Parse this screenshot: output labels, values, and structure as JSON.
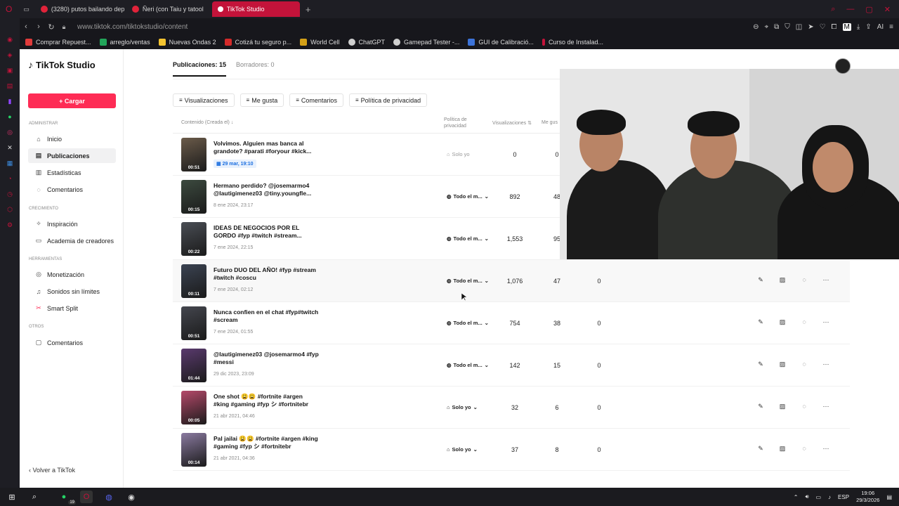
{
  "browser": {
    "tabs": [
      {
        "label": "(3280) putos bailando dep",
        "color": "#e0233a"
      },
      {
        "label": "Ñeri (con Taiu y tatool",
        "color": "#e0233a"
      },
      {
        "label": "TikTok Studio",
        "color": "#ffffff",
        "active": true
      }
    ],
    "url": "www.tiktok.com/tiktokstudio/content",
    "bookmarks": [
      {
        "label": "Comprar Repuest...",
        "color": "#e03b3b"
      },
      {
        "label": "arreglo/ventas",
        "color": "#22a55a"
      },
      {
        "label": "Nuevas Ondas 2",
        "color": "#f4c430"
      },
      {
        "label": "Cotizá tu seguro p...",
        "color": "#d42a2a"
      },
      {
        "label": "World Cell",
        "color": "#d4a017"
      },
      {
        "label": "ChatGPT",
        "color": "#cfcfcf"
      },
      {
        "label": "Gamepad Tester -...",
        "color": "#cfcfcf"
      },
      {
        "label": "GUI de Calibració...",
        "color": "#3c73d9"
      },
      {
        "label": "Curso de Instalad...",
        "color": "#c3133a"
      }
    ],
    "addr_right": "AI"
  },
  "sidebar": {
    "logo": "TikTok Studio",
    "upload_label": "+ Cargar",
    "sections": {
      "admin": "ADMINISTRAR",
      "growth": "CRECIMIENTO",
      "tools": "HERRAMIENTAS",
      "others": "OTROS"
    },
    "items": [
      {
        "label": "Inicio",
        "icon": "home-icon"
      },
      {
        "label": "Publicaciones",
        "icon": "posts-icon",
        "active": true
      },
      {
        "label": "Estadísticas",
        "icon": "chart-icon"
      },
      {
        "label": "Comentarios",
        "icon": "comment-icon"
      },
      {
        "label": "Inspiración",
        "icon": "bulb-icon"
      },
      {
        "label": "Academia de creadores",
        "icon": "academy-icon"
      },
      {
        "label": "Monetización",
        "icon": "money-icon"
      },
      {
        "label": "Sonidos sin límites",
        "icon": "music-icon"
      },
      {
        "label": "Smart Split",
        "icon": "split-icon"
      },
      {
        "label": "Comentarios",
        "icon": "comment-icon"
      }
    ],
    "back": "Volver a TikTok"
  },
  "main": {
    "tabs": [
      {
        "label": "Publicaciones: 15",
        "active": true
      },
      {
        "label": "Borradores: 0"
      }
    ],
    "filters": [
      "Visualizaciones",
      "Me gusta",
      "Comentarios",
      "Política de privacidad"
    ],
    "headers": {
      "content": "Contenido (Creada el)",
      "privacy": "Política de privacidad",
      "views": "Visualizaciones",
      "likes": "Me gus"
    },
    "rows": [
      {
        "title": "Volvimos. Alguien mas banca al grandote? #parati #foryour #kick...",
        "date": "29 mar, 19:10",
        "scheduled": true,
        "privacy": "Solo yo",
        "privacy_muted": true,
        "views": "0",
        "likes": "0",
        "comments": "",
        "duration": "00:51",
        "thumb": "#6b5b4a"
      },
      {
        "title": "Hermano perdido? @josemarmo4 @lautigimenez03 @tiny.youngfle...",
        "date": "8 ene 2024, 23:17",
        "privacy": "Todo el m...",
        "views": "892",
        "likes": "48",
        "comments": "",
        "duration": "00:15",
        "thumb": "#3c4a3f"
      },
      {
        "title": "IDEAS DE NEGOCIOS POR EL GORDO #fyp #twitch #stream...",
        "date": "7 ene 2024, 22:15",
        "privacy": "Todo el m...",
        "views": "1,553",
        "likes": "95",
        "comments": "",
        "duration": "00:22",
        "thumb": "#4a4e55"
      },
      {
        "title": "Futuro DUO DEL AÑO! #fyp #stream #twitch #coscu",
        "date": "7 ene 2024, 02:12",
        "privacy": "Todo el m...",
        "views": "1,076",
        "likes": "47",
        "comments": "0",
        "duration": "00:11",
        "thumb": "#3b4352",
        "hover": true
      },
      {
        "title": "Nunca confien en el chat #fyp#twitch #scream",
        "date": "7 ene 2024, 01:55",
        "privacy": "Todo el m...",
        "views": "754",
        "likes": "38",
        "comments": "0",
        "duration": "00:51",
        "thumb": "#44464e"
      },
      {
        "title": "@lautigimenez03 @josemarmo4 #fyp #messi",
        "date": "29 dic 2023, 23:09",
        "privacy": "Todo el m...",
        "views": "142",
        "likes": "15",
        "comments": "0",
        "duration": "01:44",
        "thumb": "#5a3a6e"
      },
      {
        "title": "One shot 😩😩 #fortnite #argen #king #gaming #fyp シ #fortnitebr",
        "date": "21 abr 2021, 04:46",
        "privacy": "Solo yo",
        "views": "32",
        "likes": "6",
        "comments": "0",
        "duration": "00:05",
        "thumb": "#b5496a"
      },
      {
        "title": "Pal jailai 😩😩 #fortnite #argen #king #gaming #fyp シ #fortnitebr",
        "date": "21 abr 2021, 04:36",
        "privacy": "Solo yo",
        "views": "37",
        "likes": "8",
        "comments": "0",
        "duration": "00:14",
        "thumb": "#8a7aa0"
      }
    ]
  },
  "taskbar": {
    "whatsapp_badge": "19",
    "lang": "ESP",
    "time": "19:06",
    "date": "29/3/2026"
  }
}
